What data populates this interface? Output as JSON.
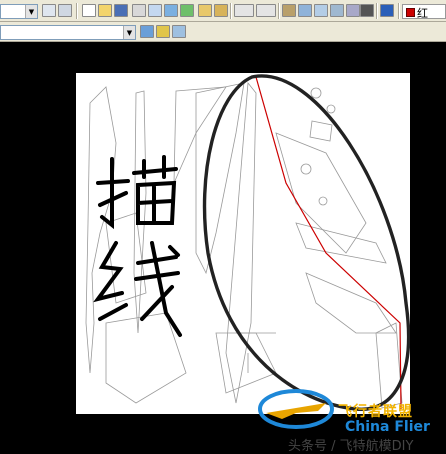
{
  "toolbar1": {
    "color_label": "红",
    "color_swatch": "#cc0000"
  },
  "toolbar2": {
    "combo_value": ""
  },
  "drawing": {
    "handwriting_line1": "描",
    "handwriting_line2": "线",
    "outline_color": "#cc0000",
    "ellipse_color": "#222222"
  },
  "watermark": {
    "cn_name": "飞行者联盟",
    "en_name": "China Flier",
    "source": "头条号 / 飞特航模DIY"
  }
}
